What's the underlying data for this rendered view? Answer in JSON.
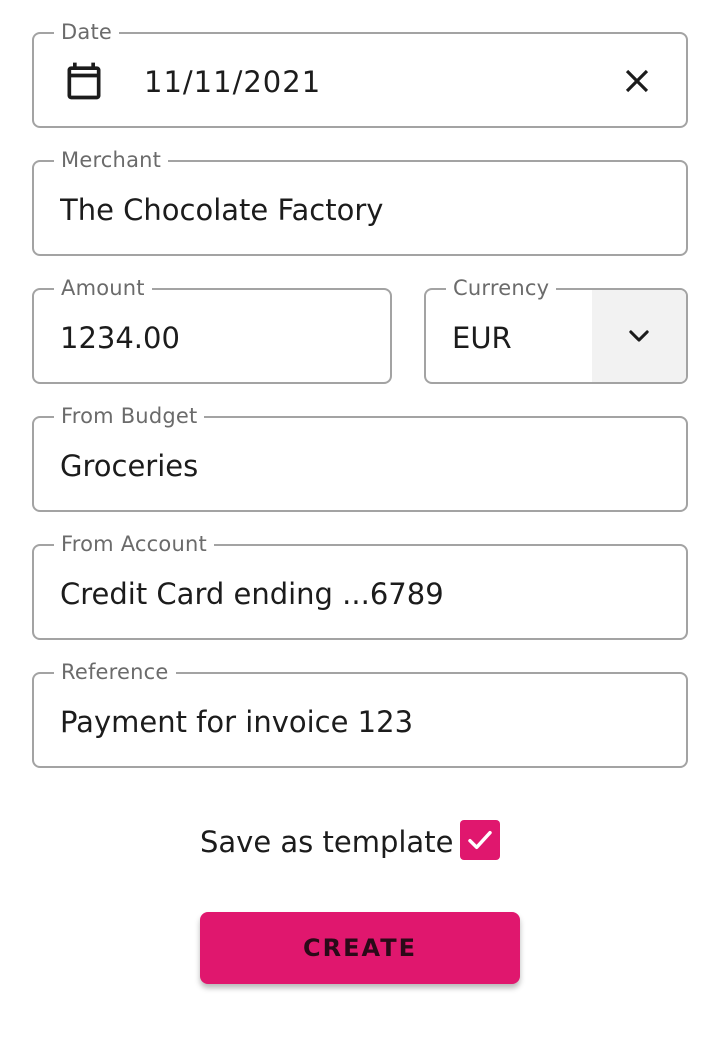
{
  "form": {
    "date": {
      "label": "Date",
      "value": "11/11/2021",
      "icon": "calendar-icon",
      "clear_icon": "close-icon"
    },
    "merchant": {
      "label": "Merchant",
      "value": "The Chocolate Factory"
    },
    "amount": {
      "label": "Amount",
      "value": "1234.00"
    },
    "currency": {
      "label": "Currency",
      "value": "EUR",
      "icon": "chevron-down-icon"
    },
    "budget": {
      "label": "From Budget",
      "value": "Groceries"
    },
    "account": {
      "label": "From Account",
      "value": "Credit Card ending ...6789"
    },
    "reference": {
      "label": "Reference",
      "value": "Payment for invoice 123"
    },
    "save_template": {
      "label": "Save as template",
      "checked": true
    },
    "submit_label": "CREATE"
  },
  "colors": {
    "accent": "#e0176e",
    "border": "#a3a3a3",
    "label": "#6b6b6b",
    "text": "#1c1c1c",
    "currency_button_bg": "#f2f2f2"
  }
}
